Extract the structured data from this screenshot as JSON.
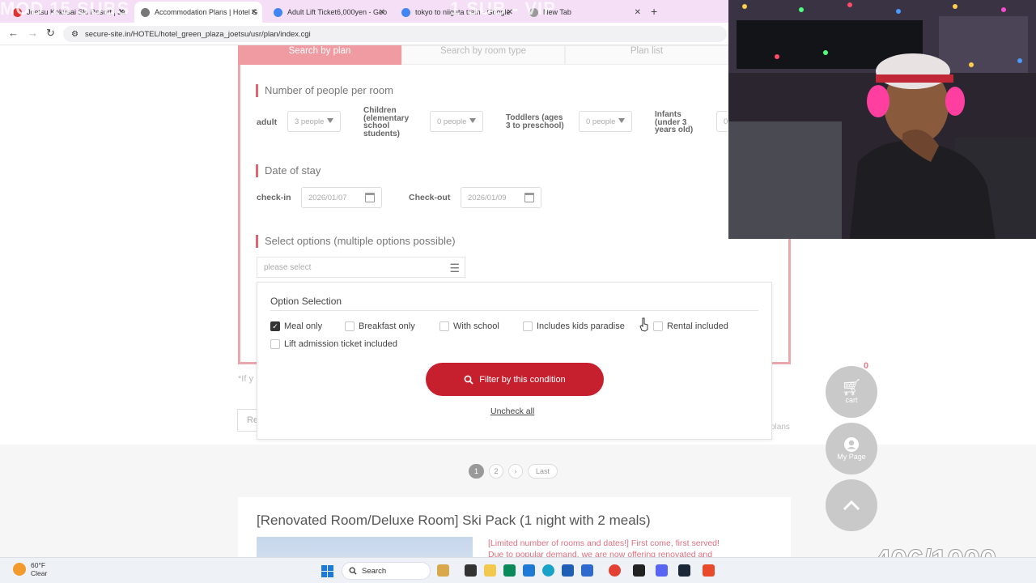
{
  "browser": {
    "tabs": [
      {
        "title": "Joetsu Kokusai Ski Resort | Ja"
      },
      {
        "title": "Accommodation Plans | Hotel G"
      },
      {
        "title": "Adult Lift Ticket6,000yen - Goo"
      },
      {
        "title": "tokyo to niigata train - Google"
      },
      {
        "title": "New Tab"
      }
    ],
    "url": "secure-site.in/HOTEL/hotel_green_plaza_joetsu/usr/plan/index.cgi",
    "overlay_left": "MOD 15 SUBS",
    "overlay_right": "1 SUB - VIP"
  },
  "page": {
    "tabs": [
      "Search by plan",
      "Search by room type",
      "Plan list"
    ],
    "people_section": "Number of people per room",
    "adult_label": "adult",
    "adult_value": "3 people",
    "children_label": [
      "Children",
      "(elementary",
      "school",
      "students)"
    ],
    "children_value": "0 people",
    "toddlers_label": [
      "Toddlers (ages",
      "3 to preschool)"
    ],
    "toddlers_value": "0 people",
    "infants_label": [
      "Infants",
      "(under 3",
      "years old)"
    ],
    "infants_value": "0",
    "date_section": "Date of stay",
    "checkin_label": "check-in",
    "checkin_value": "2026/01/07",
    "checkout_label": "Check-out",
    "checkout_value": "2026/01/09",
    "options_section": "Select options (multiple options possible)",
    "options_placeholder": "please select",
    "note": "*If y",
    "reset_label": "Re",
    "plans_link": "plans"
  },
  "popup": {
    "title": "Option Selection",
    "options": [
      {
        "label": "Meal only",
        "checked": true
      },
      {
        "label": "Breakfast only",
        "checked": false
      },
      {
        "label": "With school",
        "checked": false
      },
      {
        "label": "Includes kids paradise",
        "checked": false
      },
      {
        "label": "Rental included",
        "checked": false
      },
      {
        "label": "Lift admission ticket included",
        "checked": false
      }
    ],
    "filter_button": "Filter by this condition",
    "uncheck_all": "Uncheck all"
  },
  "pagination": [
    "1",
    "2",
    "›",
    "Last"
  ],
  "plan_card": {
    "title": "[Renovated Room/Deluxe Room] Ski Pack (1 night with 2 meals)",
    "desc_line1": "[Limited number of rooms and dates!] First come, first served!",
    "desc_line2": "Due to popular demand, we are now offering renovated and"
  },
  "floating": {
    "cart_count": "0",
    "cart_label": "cart",
    "mypage_label": "My Page"
  },
  "stream": {
    "counter": "406/1000"
  },
  "taskbar": {
    "temperature": "60°F",
    "condition": "Clear",
    "search": "Search"
  },
  "colors": {
    "accent": "#c6202e",
    "tab_active": "#ef9ba1",
    "panel_border": "#eaa8ad"
  }
}
